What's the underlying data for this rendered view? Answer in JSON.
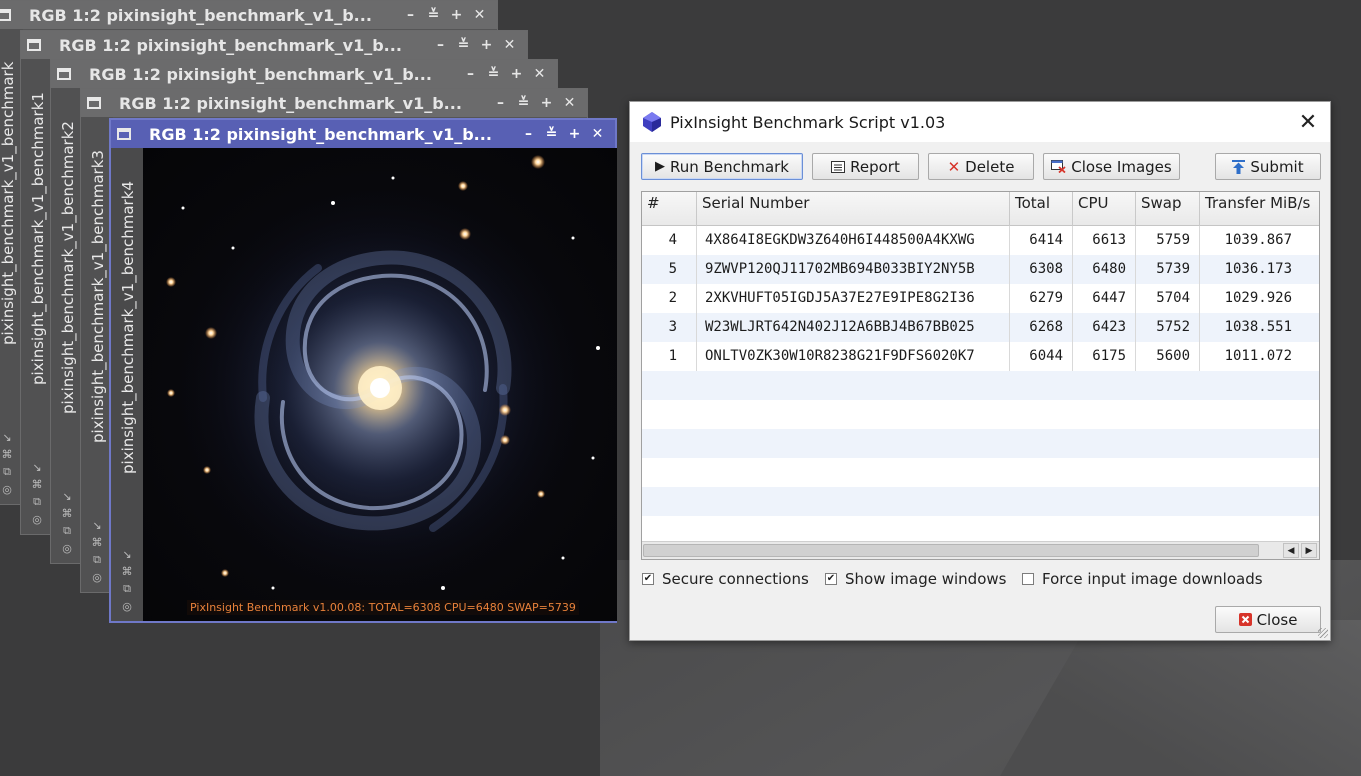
{
  "image_windows": [
    {
      "title": "RGB 1:2 pixinsight_benchmark_v1_b...",
      "sidebar_label": "pixinsight_benchmark_v1_benchmark"
    },
    {
      "title": "RGB 1:2 pixinsight_benchmark_v1_b...",
      "sidebar_label": "pixinsight_benchmark_v1_benchmark1"
    },
    {
      "title": "RGB 1:2 pixinsight_benchmark_v1_b...",
      "sidebar_label": "pixinsight_benchmark_v1_benchmark2"
    },
    {
      "title": "RGB 1:2 pixinsight_benchmark_v1_b...",
      "sidebar_label": "pixinsight_benchmark_v1_benchmark3"
    },
    {
      "title": "RGB 1:2 pixinsight_benchmark_v1_b...",
      "sidebar_label": "pixinsight_benchmark_v1_benchmark4"
    }
  ],
  "window_controls": {
    "minimize": "–",
    "shade": "≚",
    "maximize": "+",
    "close": "✕"
  },
  "image_caption": "PixInsight Benchmark v1.00.08: TOTAL=6308 CPU=6480 SWAP=5739",
  "dialog": {
    "title": "PixInsight Benchmark Script v1.03",
    "close_glyph": "✕",
    "toolbar": {
      "run_benchmark": "Run Benchmark",
      "report": "Report",
      "delete": "Delete",
      "close_images": "Close Images",
      "submit": "Submit"
    },
    "table": {
      "headers": [
        "#",
        "Serial Number",
        "Total",
        "CPU",
        "Swap",
        "Transfer MiB/s"
      ],
      "rows": [
        {
          "num": "4",
          "serial": "4X864I8EGKDW3Z640H6I448500A4KXWG",
          "total": "6414",
          "cpu": "6613",
          "swap": "5759",
          "transfer": "1039.867"
        },
        {
          "num": "5",
          "serial": "9ZWVP120QJ11702MB694B033BIY2NY5B",
          "total": "6308",
          "cpu": "6480",
          "swap": "5739",
          "transfer": "1036.173"
        },
        {
          "num": "2",
          "serial": "2XKVHUFT05IGDJ5A37E27E9IPE8G2I36",
          "total": "6279",
          "cpu": "6447",
          "swap": "5704",
          "transfer": "1029.926"
        },
        {
          "num": "3",
          "serial": "W23WLJRT642N402J12A6BBJ4B67BB025",
          "total": "6268",
          "cpu": "6423",
          "swap": "5752",
          "transfer": "1038.551"
        },
        {
          "num": "1",
          "serial": "ONLTV0ZK30W10R8238G21F9DFS6020K7",
          "total": "6044",
          "cpu": "6175",
          "swap": "5600",
          "transfer": "1011.072"
        }
      ]
    },
    "options": {
      "secure_connections": {
        "label": "Secure connections",
        "checked": true
      },
      "show_image_windows": {
        "label": "Show image windows",
        "checked": true
      },
      "force_downloads": {
        "label": "Force input image downloads",
        "checked": false
      }
    },
    "close_label": "Close"
  },
  "colors": {
    "active_title": "#5860b4",
    "delete_red": "#d7342a",
    "submit_blue": "#2f6fc9"
  }
}
